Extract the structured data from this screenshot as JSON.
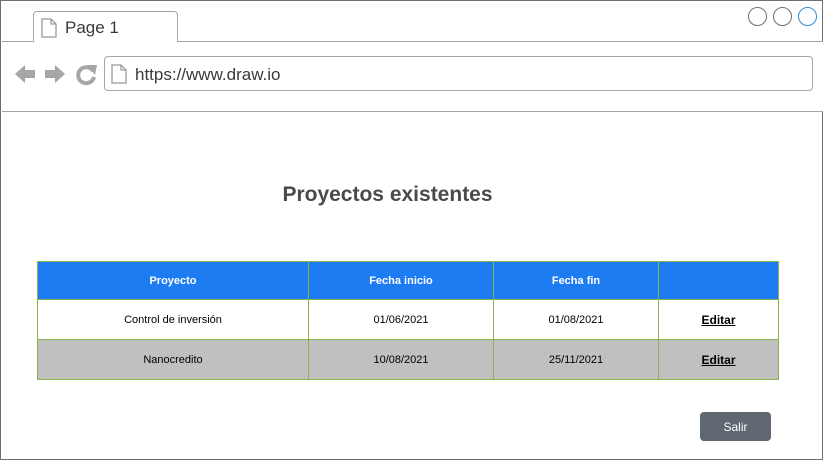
{
  "browser": {
    "tab_label": "Page 1",
    "url": "https://www.draw.io"
  },
  "page": {
    "title": "Proyectos existentes",
    "headers": [
      "Proyecto",
      "Fecha inicio",
      "Fecha fin",
      ""
    ],
    "rows": [
      {
        "proyecto": "Control de inversión",
        "fecha_inicio": "01/06/2021",
        "fecha_fin": "01/08/2021",
        "action": "Editar"
      },
      {
        "proyecto": "Nanocredito",
        "fecha_inicio": "10/08/2021",
        "fecha_fin": "25/11/2021",
        "action": "Editar"
      }
    ],
    "exit_label": "Salir"
  },
  "colors": {
    "header_bg": "#1e7cf2",
    "row_alt_bg": "#c0c0c0",
    "border": "#8ab34a",
    "button_bg": "#5f6770"
  }
}
